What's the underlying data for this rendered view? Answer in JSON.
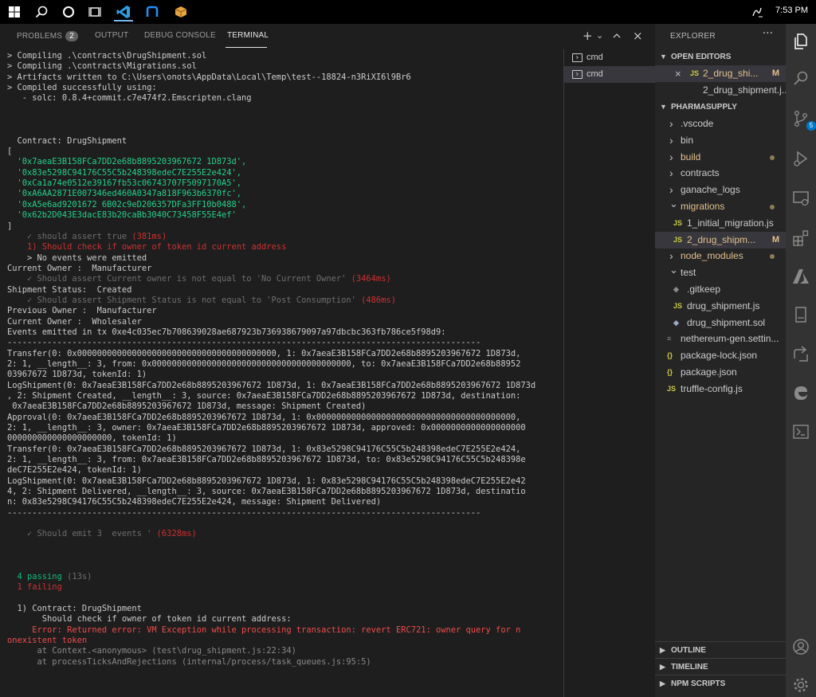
{
  "taskbar": {
    "time": "7:53 PM",
    "apps": [
      "windows-start",
      "search",
      "cortana",
      "task-view",
      "vscode",
      "git-app",
      "package-app"
    ]
  },
  "panel": {
    "tabs": [
      {
        "label": "PROBLEMS",
        "badge": "2"
      },
      {
        "label": "OUTPUT"
      },
      {
        "label": "DEBUG CONSOLE"
      },
      {
        "label": "TERMINAL",
        "active": true
      }
    ],
    "actions": {
      "new_terminal": "+",
      "dropdown": "⌄",
      "close": "×"
    }
  },
  "terminal_list": [
    {
      "label": "cmd"
    },
    {
      "label": "cmd",
      "selected": true
    }
  ],
  "terminal": {
    "lines": [
      {
        "t": "> Compiling .\\contracts\\DrugShipment.sol"
      },
      {
        "t": "> Compiling .\\contracts\\Migrations.sol"
      },
      {
        "t": "> Artifacts written to C:\\Users\\onots\\AppData\\Local\\Temp\\test--18824-n3RiXI6l9Br6"
      },
      {
        "t": "> Compiled successfully using:"
      },
      {
        "t": "   - solc: 0.8.4+commit.c7e474f2.Emscripten.clang"
      },
      {
        "t": ""
      },
      {
        "t": ""
      },
      {
        "t": ""
      },
      {
        "t": "  Contract: DrugShipment"
      },
      {
        "t": "["
      },
      {
        "t": "  '0x7aeaE3B158FCa7DD2e68b8895203967672 1D873d',",
        "c": "g"
      },
      {
        "t": "  '0x83e5298C94176C55C5b248398edeC7E255E2e424',",
        "c": "g"
      },
      {
        "t": "  '0xCa1a74e0512e39167fb53c06743707F5097170A5',",
        "c": "g"
      },
      {
        "t": "  '0xA6AA2871E007346ed460A0347a818F963b6370fc',",
        "c": "g"
      },
      {
        "t": "  '0xA5e6ad9201672 6B02c9eD206357DFa3FF10b0488',",
        "c": "g"
      },
      {
        "t": "  '0x62b2D043E3dacE83b20caBb3040C73458F55E4ef'",
        "c": "g"
      },
      {
        "t": "]"
      },
      {
        "t": "    ✓ should assert true ",
        "c": "gr",
        "tail": "(381ms)",
        "tc": "r"
      },
      {
        "t": "    1) Should check if owner of token id current address",
        "c": "r"
      },
      {
        "t": "    > No events were emitted"
      },
      {
        "t": "Current Owner :  Manufacturer"
      },
      {
        "t": "    ✓ Should assert Current owner is not equal to 'No Current Owner' ",
        "c": "gr",
        "tail": "(3464ms)",
        "tc": "r"
      },
      {
        "t": "Shipment Status:  Created"
      },
      {
        "t": "    ✓ Should assert Shipment Status is not equal to 'Post Consumption' ",
        "c": "gr",
        "tail": "(486ms)",
        "tc": "r"
      },
      {
        "t": "Previous Owner :  Manufacturer"
      },
      {
        "t": "Current Owner :  Wholesaler"
      },
      {
        "t": "Events emitted in tx 0xe4c035ec7b708639028ae687923b736938679097a97dbcbc363fb786ce5f98d9:"
      },
      {
        "t": "-----------------------------------------------------------------------------------------------"
      },
      {
        "t": "Transfer(0: 0x0000000000000000000000000000000000000000, 1: 0x7aeaE3B158FCa7DD2e68b8895203967672 1D873d,"
      },
      {
        "t": "2: 1, __length__: 3, from: 0x0000000000000000000000000000000000000000, to: 0x7aeaE3B158FCa7DD2e68b88952"
      },
      {
        "t": "03967672 1D873d, tokenId: 1)"
      },
      {
        "t": "LogShipment(0: 0x7aeaE3B158FCa7DD2e68b8895203967672 1D873d, 1: 0x7aeaE3B158FCa7DD2e68b8895203967672 1D873d"
      },
      {
        "t": ", 2: Shipment Created, __length__: 3, source: 0x7aeaE3B158FCa7DD2e68b8895203967672 1D873d, destination:"
      },
      {
        "t": " 0x7aeaE3B158FCa7DD2e68b8895203967672 1D873d, message: Shipment Created)"
      },
      {
        "t": "Approval(0: 0x7aeaE3B158FCa7DD2e68b8895203967672 1D873d, 1: 0x0000000000000000000000000000000000000000,"
      },
      {
        "t": "2: 1, __length__: 3, owner: 0x7aeaE3B158FCa7DD2e68b8895203967672 1D873d, approved: 0x0000000000000000000"
      },
      {
        "t": "000000000000000000000, tokenId: 1)"
      },
      {
        "t": "Transfer(0: 0x7aeaE3B158FCa7DD2e68b8895203967672 1D873d, 1: 0x83e5298C94176C55C5b248398edeC7E255E2e424,"
      },
      {
        "t": "2: 1, __length__: 3, from: 0x7aeaE3B158FCa7DD2e68b8895203967672 1D873d, to: 0x83e5298C94176C55C5b248398e"
      },
      {
        "t": "deC7E255E2e424, tokenId: 1)"
      },
      {
        "t": "LogShipment(0: 0x7aeaE3B158FCa7DD2e68b8895203967672 1D873d, 1: 0x83e5298C94176C55C5b248398edeC7E255E2e42"
      },
      {
        "t": "4, 2: Shipment Delivered, __length__: 3, source: 0x7aeaE3B158FCa7DD2e68b8895203967672 1D873d, destinatio"
      },
      {
        "t": "n: 0x83e5298C94176C55C5b248398edeC7E255E2e424, message: Shipment Delivered)"
      },
      {
        "t": "-----------------------------------------------------------------------------------------------"
      },
      {
        "t": ""
      },
      {
        "t": "    ✓ Should emit 3  events ' ",
        "c": "gr",
        "tail": "(6328ms)",
        "tc": "r"
      },
      {
        "t": ""
      },
      {
        "t": ""
      },
      {
        "t": ""
      },
      {
        "t": "  4 passing ",
        "c": "gd",
        "tail": "(13s)",
        "tc": "gr"
      },
      {
        "t": "  1 failing",
        "c": "r"
      },
      {
        "t": ""
      },
      {
        "t": "  1) Contract: DrugShipment"
      },
      {
        "t": "       Should check if owner of token id current address:"
      },
      {
        "t": "     Error: Returned error: VM Exception while processing transaction: revert ERC721: owner query for n",
        "c": "rb"
      },
      {
        "t": "onexistent token",
        "c": "rb"
      },
      {
        "t": "      at Context.<anonymous> (test\\drug_shipment.js:22:34)",
        "c": "dim"
      },
      {
        "t": "      at processTicksAndRejections (internal/process/task_queues.js:95:5)",
        "c": "dim"
      }
    ]
  },
  "explorer": {
    "title": "EXPLORER",
    "more": "···",
    "open_editors": {
      "label": "OPEN EDITORS",
      "items": [
        {
          "name": "2_drug_shi...",
          "marker": "M",
          "close": "×",
          "icon": "JS"
        },
        {
          "name": "2_drug_shipment.j..."
        }
      ]
    },
    "project": {
      "label": "PHARMASUPPLY",
      "items": [
        {
          "name": ".vscode",
          "type": "folder",
          "depth": 1
        },
        {
          "name": "bin",
          "type": "folder",
          "depth": 1
        },
        {
          "name": "build",
          "type": "folder",
          "depth": 1,
          "color": "orange",
          "dot": true
        },
        {
          "name": "contracts",
          "type": "folder",
          "depth": 1
        },
        {
          "name": "ganache_logs",
          "type": "folder",
          "depth": 1
        },
        {
          "name": "migrations",
          "type": "folder-open",
          "depth": 1,
          "color": "orange",
          "dot": true
        },
        {
          "name": "1_initial_migration.js",
          "type": "js",
          "depth": 2
        },
        {
          "name": "2_drug_shipm...",
          "type": "js",
          "depth": 2,
          "color": "orange",
          "marker": "M",
          "selected": true
        },
        {
          "name": "node_modules",
          "type": "folder",
          "depth": 1,
          "color": "orange",
          "dot": true
        },
        {
          "name": "test",
          "type": "folder-open",
          "depth": 1
        },
        {
          "name": ".gitkeep",
          "type": "gitkeep",
          "depth": 2
        },
        {
          "name": "drug_shipment.js",
          "type": "js",
          "depth": 2
        },
        {
          "name": "drug_shipment.sol",
          "type": "sol",
          "depth": 2
        },
        {
          "name": "nethereum-gen.settin...",
          "type": "settings",
          "depth": 1
        },
        {
          "name": "package-lock.json",
          "type": "json",
          "depth": 1
        },
        {
          "name": "package.json",
          "type": "json",
          "depth": 1
        },
        {
          "name": "truffle-config.js",
          "type": "js",
          "depth": 1
        }
      ]
    },
    "bottom_sections": [
      {
        "label": "OUTLINE"
      },
      {
        "label": "TIMELINE"
      },
      {
        "label": "NPM SCRIPTS"
      }
    ]
  },
  "activity_bar": {
    "items": [
      "explorer-icon",
      "search-icon",
      "source-control-icon",
      "run-debug-icon",
      "remote-explorer-icon",
      "extensions-icon",
      "azure-icon",
      "test-icon",
      "live-share-icon",
      "edge-devtools-icon",
      "powershell-icon"
    ],
    "scm_badge": "5",
    "bottom": [
      "account-icon",
      "settings-gear-icon"
    ]
  },
  "colors": {
    "taskbar": "#000000",
    "terminal_bg": "#1e1e1e",
    "sidebar_bg": "#252526",
    "activity_bg": "#333333",
    "accent": "#007acc",
    "green": "#23d18b",
    "red": "#cd3131",
    "modified": "#e2c08d"
  }
}
